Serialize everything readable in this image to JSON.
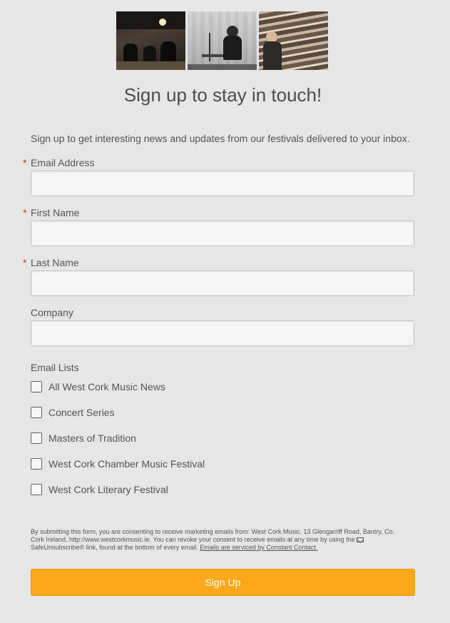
{
  "header": {
    "title": "Sign up to stay in touch!",
    "intro": "Sign up to get interesting news and updates from our festivals delivered to your inbox."
  },
  "fields": [
    {
      "label": "Email Address",
      "required": true,
      "value": "",
      "placeholder": ""
    },
    {
      "label": "First Name",
      "required": true,
      "value": "",
      "placeholder": ""
    },
    {
      "label": "Last Name",
      "required": true,
      "value": "",
      "placeholder": ""
    },
    {
      "label": "Company",
      "required": false,
      "value": "",
      "placeholder": ""
    }
  ],
  "required_marker": "*",
  "email_lists": {
    "label": "Email Lists",
    "items": [
      {
        "label": "All West Cork Music News",
        "checked": false
      },
      {
        "label": "Concert Series",
        "checked": false
      },
      {
        "label": "Masters of Tradition",
        "checked": false
      },
      {
        "label": "West Cork Chamber Music Festival",
        "checked": false
      },
      {
        "label": "West Cork Literary Festival",
        "checked": false
      }
    ]
  },
  "consent": {
    "text_before": "By submitting this form, you are consenting to receive marketing emails from: West Cork Music, 13 Glengarriff Road, Bantry, Co. Cork Ireland, http://www.westcorkmusic.ie. You can revoke your consent to receive emails at any time by using the ",
    "safeunsubscribe": "SafeUnsubscribe® link, found at the bottom of every email.",
    "service_link": "Emails are serviced by Constant Contact."
  },
  "submit": {
    "label": "Sign Up"
  },
  "colors": {
    "background": "#e6e6e6",
    "button": "#fba91a",
    "required": "#d0312d"
  },
  "icons": [
    "envelope-icon"
  ]
}
